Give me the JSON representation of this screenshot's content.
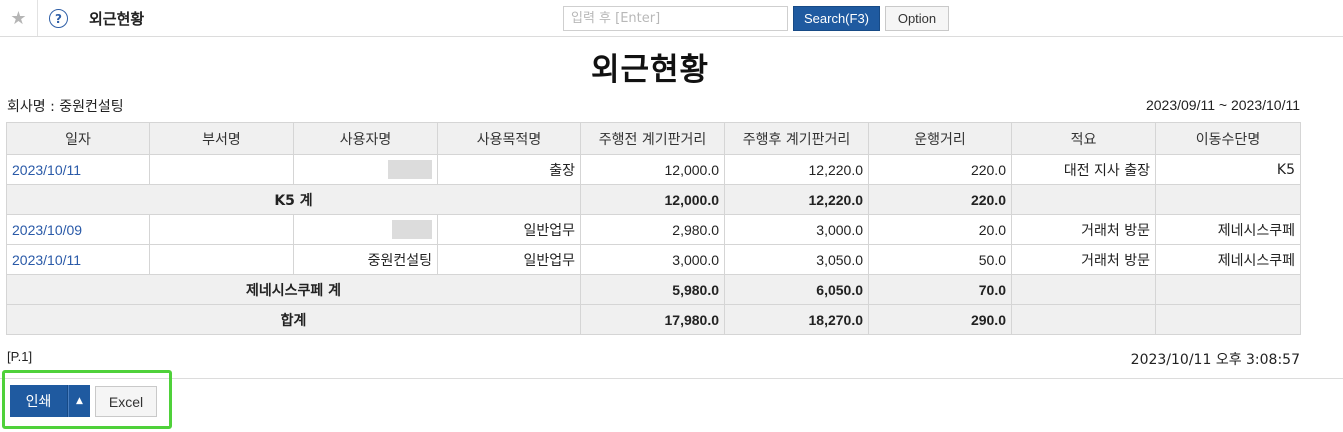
{
  "topbar": {
    "star_glyph": "★",
    "help_glyph": "?",
    "page_name": "외근현황",
    "search_placeholder": "입력 후 [Enter]",
    "search_label": "Search(F3)",
    "option_label": "Option"
  },
  "report": {
    "title": "외근현황",
    "company": "회사명 : 중원컨설팅",
    "period": "2023/09/11 ~ 2023/10/11",
    "columns": [
      "일자",
      "부서명",
      "사용자명",
      "사용목적명",
      "주행전 계기판거리",
      "주행후 계기판거리",
      "운행거리",
      "적요",
      "이동수단명"
    ],
    "rows": [
      {
        "date": "2023/10/11",
        "dept": "",
        "user": "",
        "purpose": "출장",
        "before": "12,000.0",
        "after": "12,220.0",
        "distance": "220.0",
        "memo": "대전 지사 출장",
        "vehicle": "K5"
      },
      {
        "label": "K5 계",
        "before": "12,000.0",
        "after": "12,220.0",
        "distance": "220.0"
      },
      {
        "date": "2023/10/09",
        "dept": "",
        "user": "",
        "purpose": "일반업무",
        "before": "2,980.0",
        "after": "3,000.0",
        "distance": "20.0",
        "memo": "거래처 방문",
        "vehicle": "제네시스쿠페"
      },
      {
        "date": "2023/10/11",
        "dept": "",
        "user": "중원컨설팅",
        "purpose": "일반업무",
        "before": "3,000.0",
        "after": "3,050.0",
        "distance": "50.0",
        "memo": "거래처 방문",
        "vehicle": "제네시스쿠페"
      },
      {
        "label": "제네시스쿠페 계",
        "before": "5,980.0",
        "after": "6,050.0",
        "distance": "70.0"
      },
      {
        "label": "합계",
        "before": "17,980.0",
        "after": "18,270.0",
        "distance": "290.0"
      }
    ],
    "page_no": "[P.1]",
    "printed_at": "2023/10/11 오후 3:08:57"
  },
  "footer": {
    "print_label": "인쇄",
    "print_dropdown_glyph": "▲",
    "excel_label": "Excel",
    "highlight_color": "#4fd13a"
  }
}
